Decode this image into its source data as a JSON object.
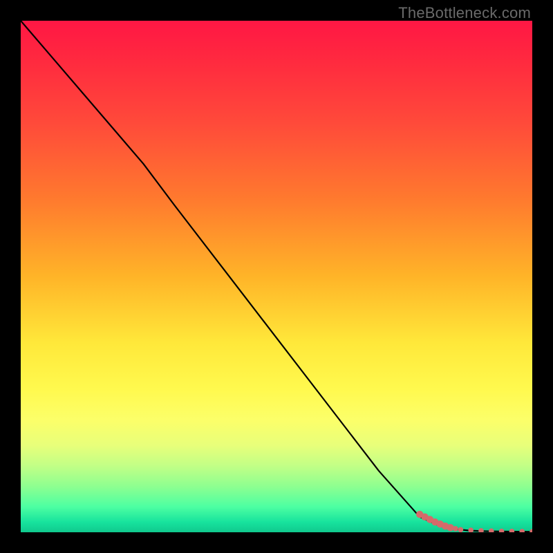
{
  "watermark": "TheBottleneck.com",
  "chart_data": {
    "type": "line",
    "title": "",
    "xlabel": "",
    "ylabel": "",
    "xlim": [
      0,
      100
    ],
    "ylim": [
      0,
      100
    ],
    "grid": false,
    "legend": false,
    "background": "rainbow-vertical-gradient",
    "series": [
      {
        "name": "curve",
        "style": "line",
        "color": "#000000",
        "x": [
          0,
          6,
          12,
          18,
          24,
          30,
          40,
          50,
          60,
          70,
          78,
          82,
          85,
          88,
          91,
          94,
          97,
          100
        ],
        "y": [
          100,
          93,
          86,
          79,
          72,
          64,
          51,
          38,
          25,
          12,
          3,
          1.2,
          0.6,
          0.3,
          0.2,
          0.15,
          0.12,
          0.1
        ]
      },
      {
        "name": "tail-markers",
        "style": "scatter",
        "color": "#d46a6a",
        "x": [
          78,
          79,
          80,
          81,
          82,
          83,
          84,
          85,
          86,
          88,
          90,
          92,
          94,
          96,
          98,
          100
        ],
        "y": [
          3.5,
          3.0,
          2.5,
          2.0,
          1.6,
          1.2,
          0.9,
          0.7,
          0.5,
          0.4,
          0.3,
          0.25,
          0.2,
          0.18,
          0.15,
          0.12
        ]
      }
    ]
  }
}
